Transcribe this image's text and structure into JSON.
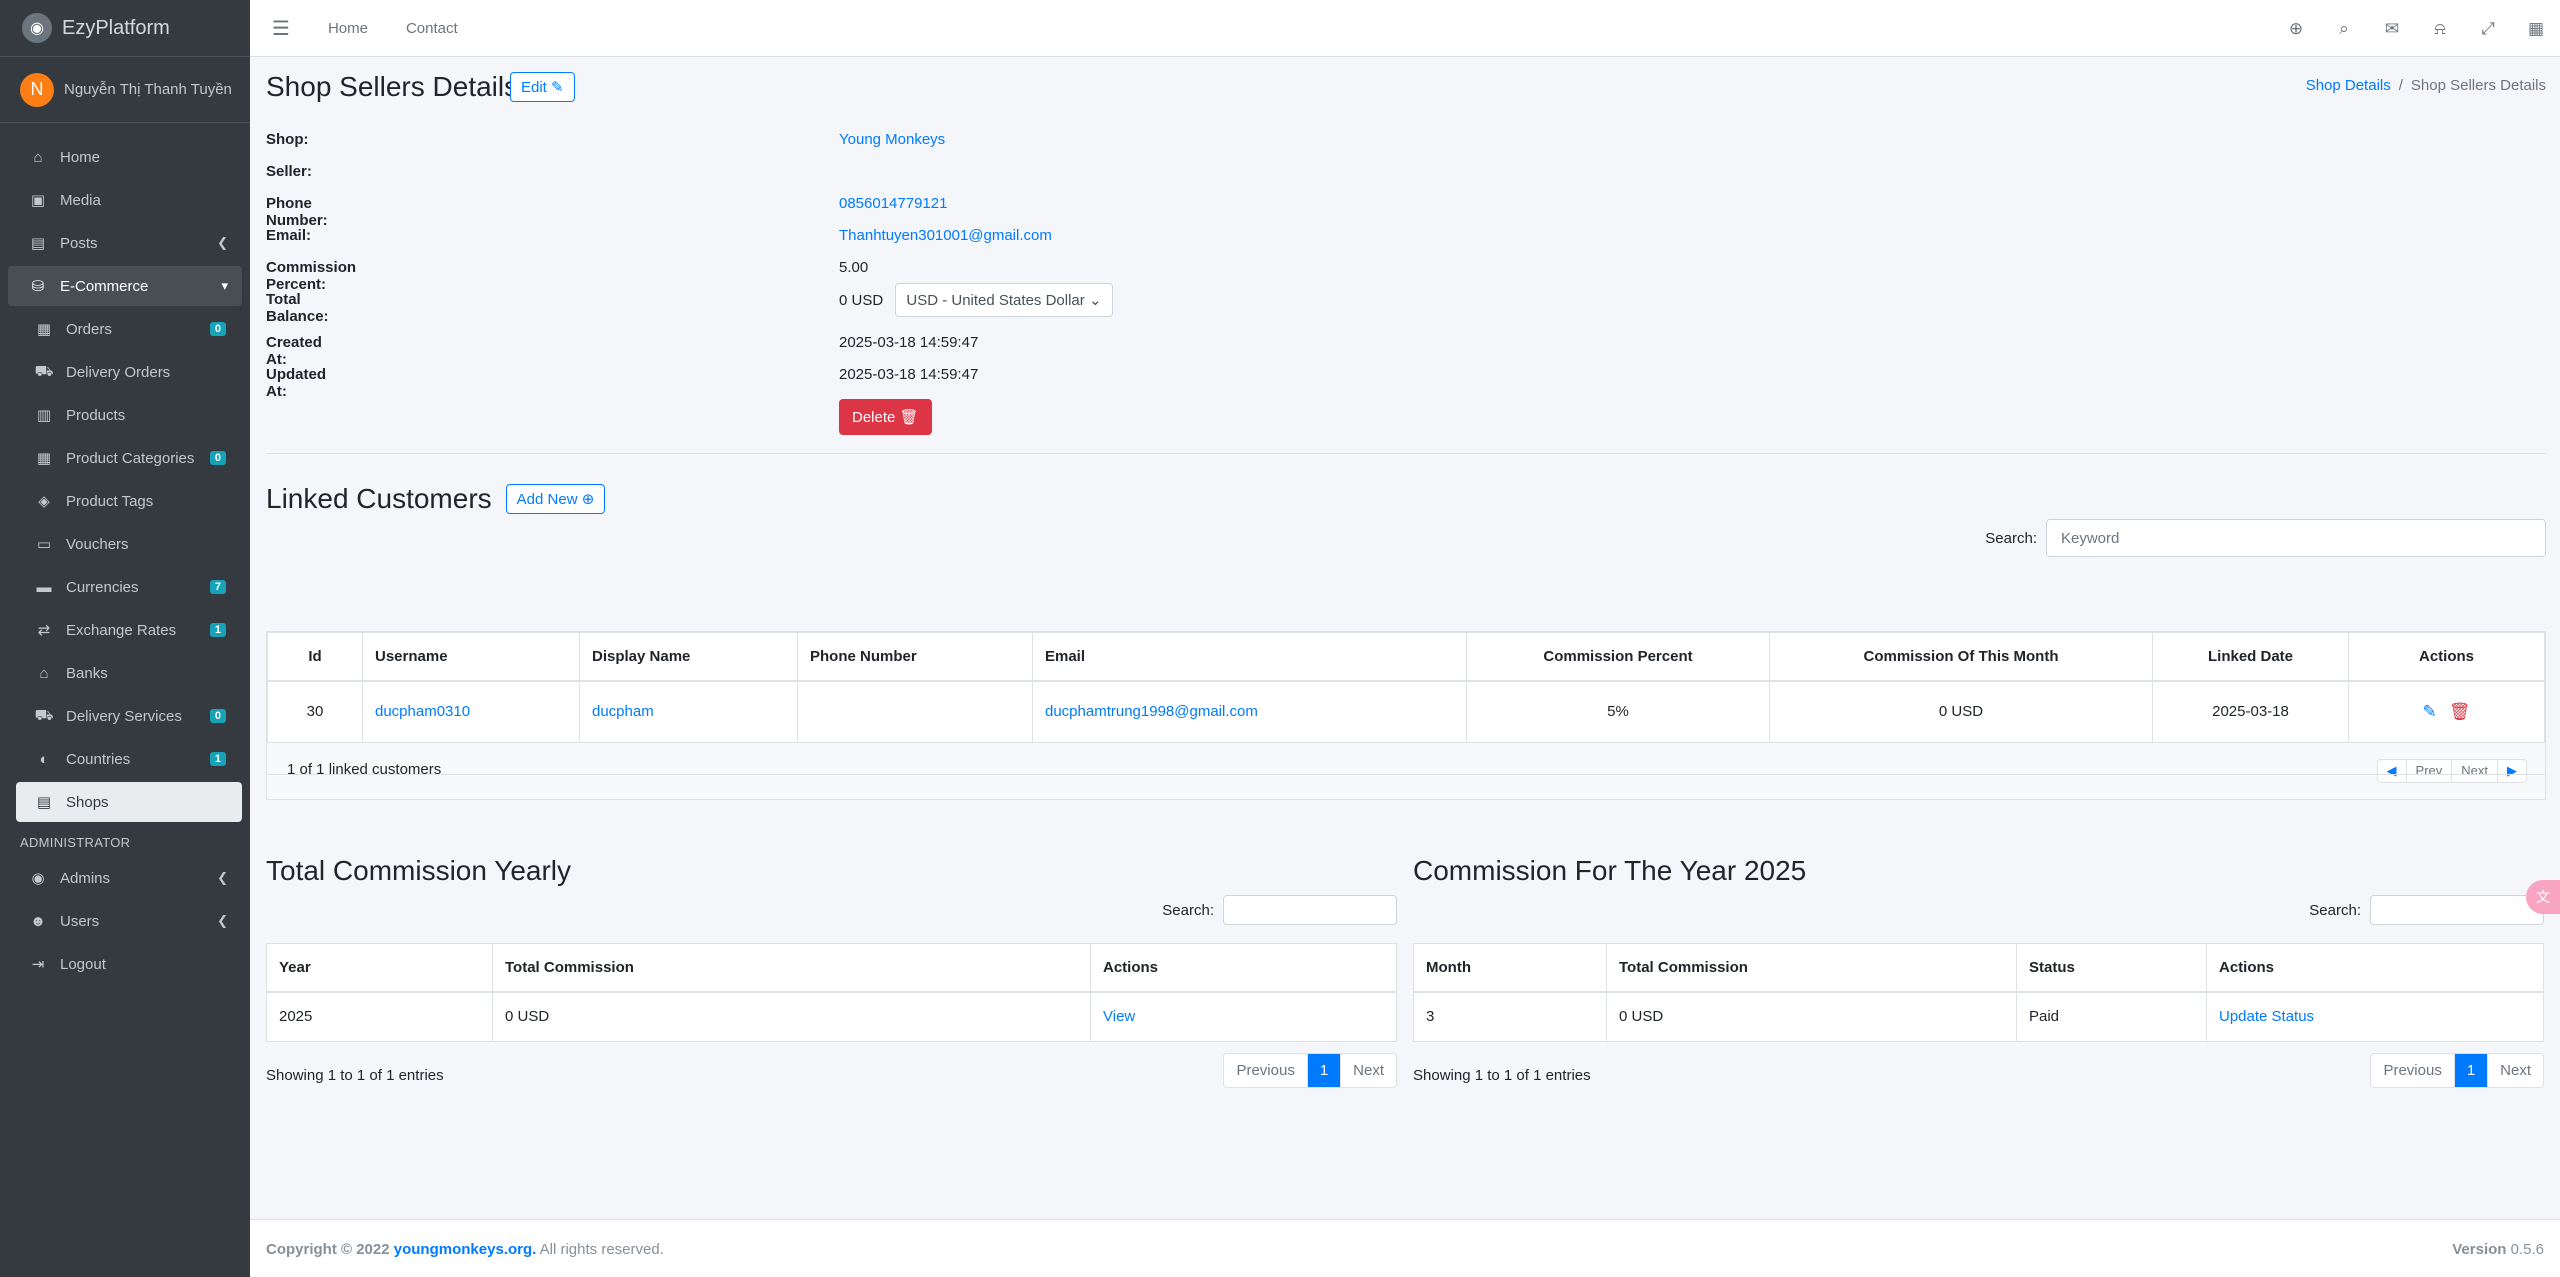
{
  "brand": {
    "name": "EzyPlatform",
    "logo_icon": "platform-logo-icon"
  },
  "user": {
    "initial": "N",
    "name": "Nguyễn Thị Thanh Tuyền"
  },
  "sidebar": {
    "items": [
      {
        "label": "Home",
        "icon": "home-icon"
      },
      {
        "label": "Media",
        "icon": "image-icon"
      },
      {
        "label": "Posts",
        "icon": "posts-icon"
      },
      {
        "label": "E-Commerce",
        "icon": "basket-icon"
      },
      {
        "label": "Orders",
        "icon": "clipboard-icon",
        "badge": "0"
      },
      {
        "label": "Delivery Orders",
        "icon": "dolly-icon"
      },
      {
        "label": "Products",
        "icon": "boxes-icon"
      },
      {
        "label": "Product Categories",
        "icon": "clipboard-icon",
        "badge": "0"
      },
      {
        "label": "Product Tags",
        "icon": "tags-icon"
      },
      {
        "label": "Vouchers",
        "icon": "ticket-icon"
      },
      {
        "label": "Currencies",
        "icon": "money-icon",
        "badge": "7"
      },
      {
        "label": "Exchange Rates",
        "icon": "exchange-icon",
        "badge": "1"
      },
      {
        "label": "Banks",
        "icon": "bank-icon"
      },
      {
        "label": "Delivery Services",
        "icon": "truck-icon",
        "badge": "0"
      },
      {
        "label": "Countries",
        "icon": "globe-icon",
        "badge": "1"
      },
      {
        "label": "Shops",
        "icon": "store-icon"
      }
    ],
    "admin_header": "ADMINISTRATOR",
    "admin_items": [
      {
        "label": "Admins",
        "icon": "user-circle-icon"
      },
      {
        "label": "Users",
        "icon": "users-icon"
      },
      {
        "label": "Logout",
        "icon": "logout-icon"
      }
    ]
  },
  "topbar": {
    "home": "Home",
    "contact": "Contact"
  },
  "page": {
    "title": "Shop Sellers Details",
    "edit_label": "Edit",
    "breadcrumb": {
      "parent": "Shop Details",
      "current": "Shop Sellers Details"
    }
  },
  "details": {
    "shop_label": "Shop:",
    "shop_value": "Young Monkeys",
    "seller_label": "Seller:",
    "seller_value": "",
    "phone_label": "Phone Number:",
    "phone_value": "0856014779121",
    "email_label": "Email:",
    "email_value": "Thanhtuyen301001@gmail.com",
    "commission_label": "Commission Percent:",
    "commission_value": "5.00",
    "balance_label": "Total Balance:",
    "balance_value": "0 USD",
    "currency_selected": "USD - United States Dollar",
    "created_label": "Created At:",
    "created_value": "2025-03-18 14:59:47",
    "updated_label": "Updated At:",
    "updated_value": "2025-03-18 14:59:47",
    "delete_label": "Delete"
  },
  "linked": {
    "title": "Linked Customers",
    "add_label": "Add New",
    "search_label": "Search:",
    "search_placeholder": "Keyword",
    "columns": [
      "Id",
      "Username",
      "Display Name",
      "Phone Number",
      "Email",
      "Commission Percent",
      "Commission Of This Month",
      "Linked Date",
      "Actions"
    ],
    "row": {
      "id": "30",
      "username": "ducpham0310",
      "display_name": "ducpham",
      "phone": "",
      "email": "ducphamtrung1998@gmail.com",
      "percent": "5%",
      "month": "0 USD",
      "date": "2025-03-18"
    },
    "info": "1 of 1 linked customers",
    "prev": "Prev",
    "next": "Next"
  },
  "yearly": {
    "title": "Total Commission Yearly",
    "search_label": "Search:",
    "columns": [
      "Year",
      "Total Commission",
      "Actions"
    ],
    "row": {
      "year": "2025",
      "total": "0 USD",
      "action": "View"
    },
    "showing": "Showing 1 to 1 of 1 entries",
    "previous": "Previous",
    "page": "1",
    "next": "Next"
  },
  "monthly": {
    "title": "Commission For The Year 2025",
    "search_label": "Search:",
    "columns": [
      "Month",
      "Total Commission",
      "Status",
      "Actions"
    ],
    "row": {
      "month": "3",
      "total": "0 USD",
      "status": "Paid",
      "action": "Update Status"
    },
    "showing": "Showing 1 to 1 of 1 entries",
    "previous": "Previous",
    "page": "1",
    "next": "Next"
  },
  "footer": {
    "copyright": "Copyright © 2022",
    "site": "youngmonkeys.org.",
    "rights": "All rights reserved.",
    "version_label": "Version",
    "version": "0.5.6"
  }
}
